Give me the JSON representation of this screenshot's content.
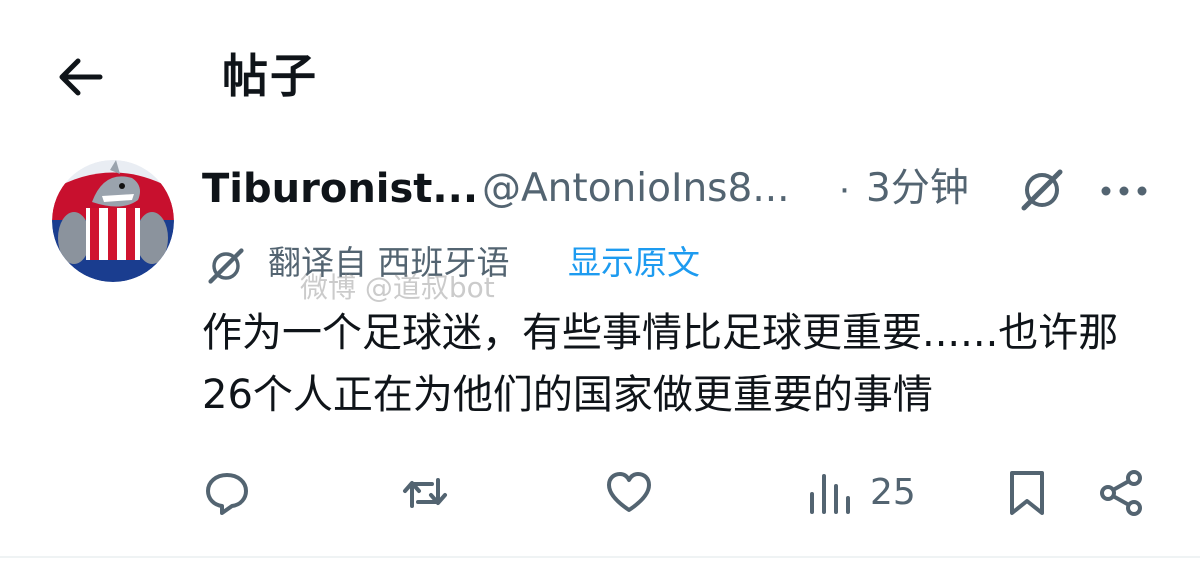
{
  "header": {
    "title": "帖子",
    "back_icon": "arrow-left-icon"
  },
  "post": {
    "author": {
      "display_name": "Tiburonist...",
      "handle": "@AntonioIns8...",
      "avatar": "shark-mascot-avatar"
    },
    "separator": "·",
    "time": "3分钟",
    "translation": {
      "label": "翻译自 西班牙语",
      "show_original": "显示原文"
    },
    "text": "作为一个足球迷，有些事情比足球更重要......也许那26个人正在为他们的国家做更重要的事情",
    "watermark": "微博 @道叔bot",
    "actions": {
      "reply_icon": "reply-icon",
      "repost_icon": "repost-icon",
      "like_icon": "heart-icon",
      "views_icon": "views-icon",
      "views_count": "25",
      "bookmark_icon": "bookmark-icon",
      "share_icon": "share-icon"
    }
  },
  "colors": {
    "text_primary": "#0f1419",
    "text_secondary": "#536471",
    "link": "#1d9bf0",
    "background": "#ffffff"
  }
}
